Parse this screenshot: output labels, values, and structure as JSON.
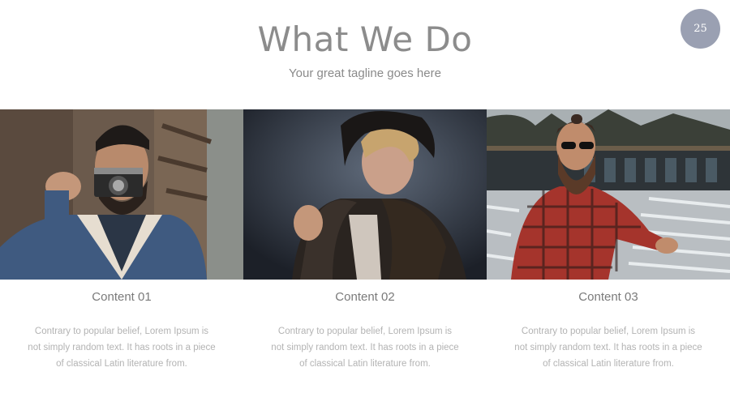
{
  "slide": {
    "title": "What We Do",
    "tagline": "Your great tagline goes here",
    "page_number": "25"
  },
  "columns": [
    {
      "title": "Content 01",
      "text": "Contrary to popular belief, Lorem Ipsum is not simply random text. It has roots in a piece of classical Latin literature from.",
      "image": "man-with-camera-photo"
    },
    {
      "title": "Content 02",
      "text": "Contrary to popular belief, Lorem Ipsum is not simply random text. It has roots in a piece of classical Latin literature from.",
      "image": "woman-in-fur-photo"
    },
    {
      "title": "Content 03",
      "text": "Contrary to popular belief, Lorem Ipsum is not simply random text. It has roots in a piece of classical Latin literature from.",
      "image": "bearded-man-plaid-photo"
    }
  ],
  "colors": {
    "badge": "#9aa0b2",
    "title": "#8c8c8c",
    "body_text": "#b3b3b3"
  }
}
